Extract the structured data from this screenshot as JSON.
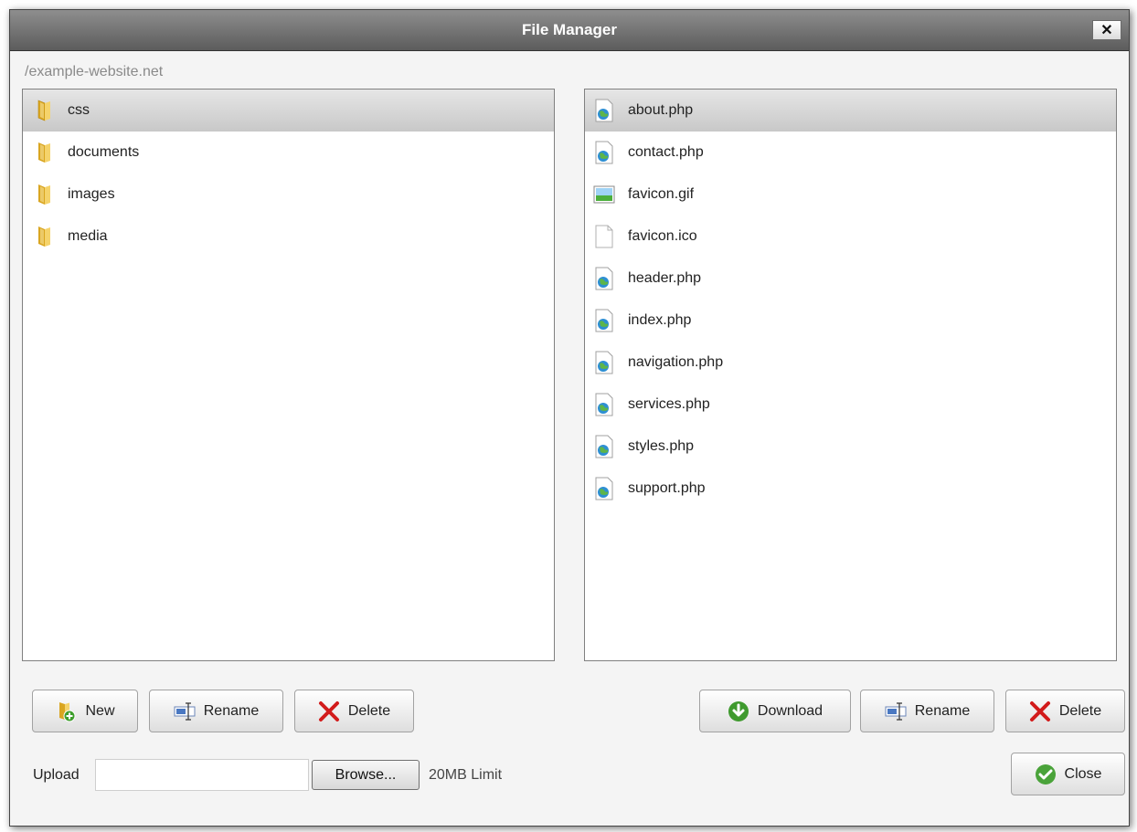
{
  "window": {
    "title": "File Manager",
    "close_glyph": "✕"
  },
  "path": "/example-website.net",
  "folders": [
    {
      "name": "css",
      "icon": "folder-icon",
      "selected": true
    },
    {
      "name": "documents",
      "icon": "folder-icon",
      "selected": false
    },
    {
      "name": "images",
      "icon": "folder-icon",
      "selected": false
    },
    {
      "name": "media",
      "icon": "folder-icon",
      "selected": false
    }
  ],
  "files": [
    {
      "name": "about.php",
      "icon": "php-file-icon",
      "selected": true
    },
    {
      "name": "contact.php",
      "icon": "php-file-icon",
      "selected": false
    },
    {
      "name": "favicon.gif",
      "icon": "image-file-icon",
      "selected": false
    },
    {
      "name": "favicon.ico",
      "icon": "blank-file-icon",
      "selected": false
    },
    {
      "name": "header.php",
      "icon": "php-file-icon",
      "selected": false
    },
    {
      "name": "index.php",
      "icon": "php-file-icon",
      "selected": false
    },
    {
      "name": "navigation.php",
      "icon": "php-file-icon",
      "selected": false
    },
    {
      "name": "services.php",
      "icon": "php-file-icon",
      "selected": false
    },
    {
      "name": "styles.php",
      "icon": "php-file-icon",
      "selected": false
    },
    {
      "name": "support.php",
      "icon": "php-file-icon",
      "selected": false
    }
  ],
  "folder_actions": {
    "new": "New",
    "rename": "Rename",
    "delete": "Delete"
  },
  "file_actions": {
    "download": "Download",
    "rename": "Rename",
    "delete": "Delete",
    "close": "Close"
  },
  "upload": {
    "label": "Upload",
    "value": "",
    "browse": "Browse...",
    "limit": "20MB Limit"
  },
  "colors": {
    "titlebar": "#6e6e6e",
    "selected_row": "#d0d0d0",
    "folder": "#e9bc3a",
    "download": "#3f9a2e",
    "delete": "#d21b1b"
  }
}
